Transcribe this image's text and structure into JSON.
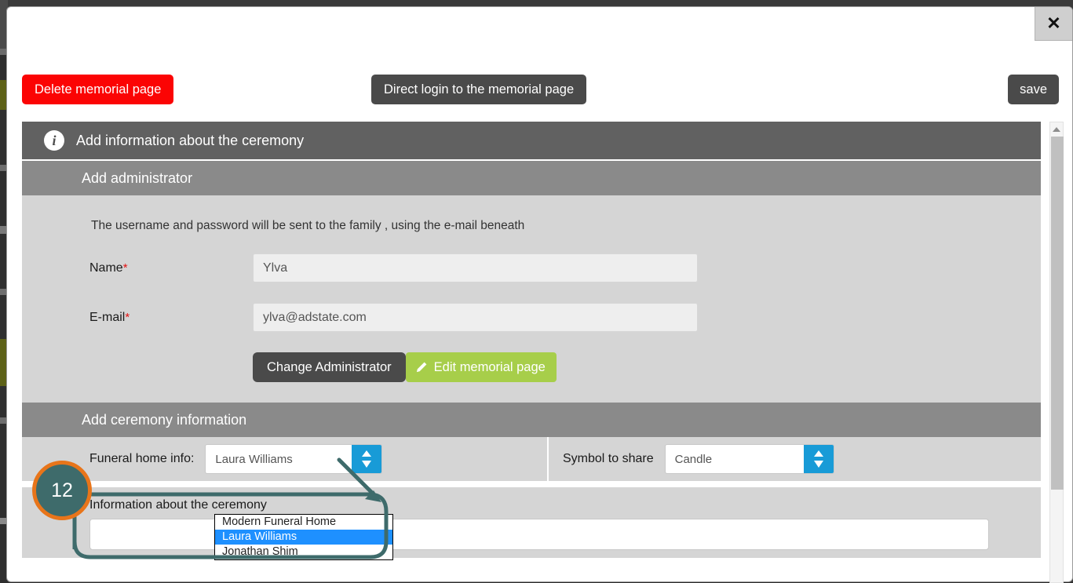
{
  "window": {
    "close_label": "✕"
  },
  "toolbar": {
    "delete_label": "Delete memorial page",
    "direct_login_label": "Direct login to the memorial page",
    "save_label": "save"
  },
  "sections": {
    "ceremony_header": "Add information about the ceremony",
    "admin_header": "Add administrator",
    "admin_note": "The username and password will be sent to the family , using the e-mail beneath",
    "ceremony_info_header": "Add ceremony information"
  },
  "form": {
    "name_label": "Name",
    "name_required": "*",
    "name_value": "Ylva",
    "email_label": "E-mail",
    "email_required": "*",
    "email_value": "ylva@adstate.com",
    "change_admin_label": "Change Administrator",
    "edit_memorial_label": "Edit memorial page"
  },
  "ceremony": {
    "funeral_home_label": "Funeral home info:",
    "funeral_home_value": "Laura Williams",
    "funeral_home_options": [
      "Modern Funeral Home",
      "Laura Williams",
      "Jonathan Shim"
    ],
    "funeral_home_selected_index": 1,
    "symbol_label": "Symbol to share",
    "symbol_value": "Candle",
    "info_caption": "Information about the ceremony",
    "info_value": ""
  },
  "annotation": {
    "step_number": "12"
  },
  "colors": {
    "danger": "#fb0404",
    "dark_button": "#4a4a4a",
    "accent_green": "#a7ce4a",
    "select_blue": "#189bd7",
    "highlight_blue": "#1e90ff",
    "header_dark": "#616161",
    "header_mid": "#8a8a8a",
    "panel_gray": "#d5d5d5",
    "annotation_ring": "#e8751a",
    "annotation_fill": "#3e6b6b"
  }
}
